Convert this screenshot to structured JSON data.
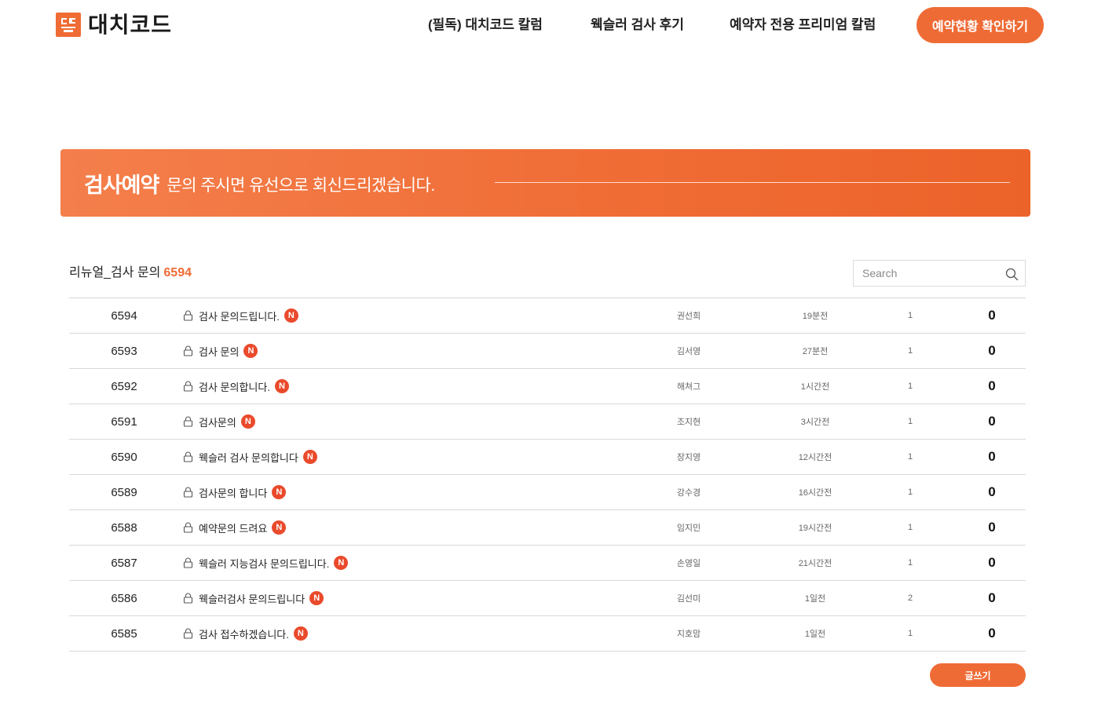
{
  "header": {
    "logo_text": "대치코드",
    "nav": [
      {
        "label": "(필독) 대치코드 칼럼"
      },
      {
        "label": "웩슬러 검사 후기"
      },
      {
        "label": "예약자 전용 프리미엄 칼럼"
      }
    ],
    "cta_label": "예약현황 확인하기"
  },
  "banner": {
    "title": "검사예약",
    "subtitle": "문의 주시면 유선으로 회신드리겠습니다."
  },
  "board": {
    "title": "리뉴얼_검사 문의",
    "count": "6594",
    "search_placeholder": "Search",
    "write_label": "글쓰기",
    "new_badge": "N",
    "rows": [
      {
        "num": "6594",
        "subject": "검사 문의드립니다.",
        "author": "권선희",
        "date": "19분전",
        "views": "1",
        "likes": "0"
      },
      {
        "num": "6593",
        "subject": "검사 문의",
        "author": "김서영",
        "date": "27분전",
        "views": "1",
        "likes": "0"
      },
      {
        "num": "6592",
        "subject": "검사 문의합니다.",
        "author": "해쳐그",
        "date": "1시간전",
        "views": "1",
        "likes": "0"
      },
      {
        "num": "6591",
        "subject": "검사문의",
        "author": "조지현",
        "date": "3시간전",
        "views": "1",
        "likes": "0"
      },
      {
        "num": "6590",
        "subject": "웩슬러 검사 문의합니다",
        "author": "장지영",
        "date": "12시간전",
        "views": "1",
        "likes": "0"
      },
      {
        "num": "6589",
        "subject": "검사문의 합니다",
        "author": "강수경",
        "date": "16시간전",
        "views": "1",
        "likes": "0"
      },
      {
        "num": "6588",
        "subject": "예약문의 드려요",
        "author": "임지민",
        "date": "19시간전",
        "views": "1",
        "likes": "0"
      },
      {
        "num": "6587",
        "subject": "웩슬러 지능검사 문의드립니다.",
        "author": "손영일",
        "date": "21시간전",
        "views": "1",
        "likes": "0"
      },
      {
        "num": "6586",
        "subject": "웩슬러검사 문의드립니다",
        "author": "김선미",
        "date": "1일전",
        "views": "2",
        "likes": "0"
      },
      {
        "num": "6585",
        "subject": "검사 접수하겠습니다.",
        "author": "지호맘",
        "date": "1일전",
        "views": "1",
        "likes": "0"
      }
    ]
  },
  "colors": {
    "accent": "#ef6b35",
    "badge": "#ea4a2c"
  },
  "icons": {
    "logo": "logo-mark-icon",
    "search": "search-icon",
    "lock": "lock-icon"
  }
}
